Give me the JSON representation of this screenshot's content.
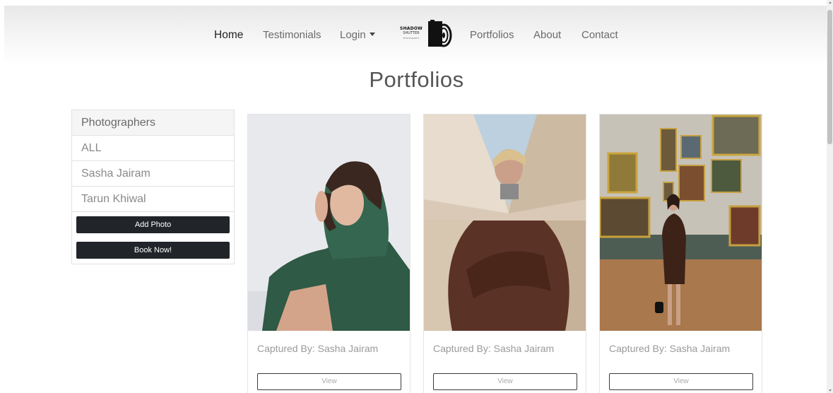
{
  "nav": {
    "home": "Home",
    "testimonials": "Testimonials",
    "login": "Login",
    "portfolios": "Portfolios",
    "about": "About",
    "contact": "Contact"
  },
  "logo": {
    "line1": "SHADOW",
    "line2": "SHUTTER",
    "line3": "PHOTOGRAPHY"
  },
  "page": {
    "title": "Portfolios"
  },
  "sidebar": {
    "header": "Photographers",
    "items": [
      "ALL",
      "Sasha Jairam",
      "Tarun Khiwal"
    ],
    "add_photo": "Add Photo",
    "book_now": "Book Now!"
  },
  "cards": [
    {
      "caption": "Captured By: Sasha Jairam",
      "button": "View"
    },
    {
      "caption": "Captured By: Sasha Jairam",
      "button": "View"
    },
    {
      "caption": "Captured By: Sasha Jairam",
      "button": "View"
    }
  ]
}
